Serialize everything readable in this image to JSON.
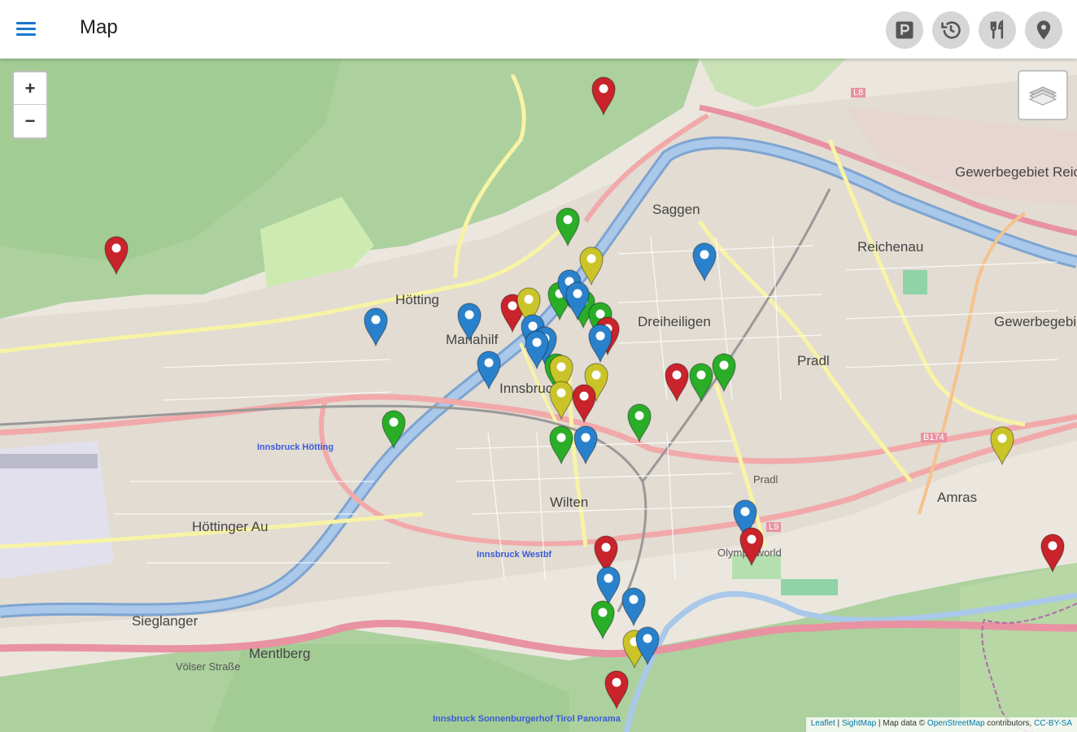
{
  "appbar": {
    "title": "Map",
    "actions": [
      {
        "icon": "parking-icon"
      },
      {
        "icon": "history-icon"
      },
      {
        "icon": "restaurant-icon"
      },
      {
        "icon": "location-pin-icon"
      }
    ]
  },
  "map": {
    "zoom_in": "+",
    "zoom_out": "−",
    "labels": {
      "innsbruck": "Innsbruck",
      "hoetting": "Hötting",
      "mariahilf": "Mariahilf",
      "saggen": "Saggen",
      "dreiheiligen": "Dreiheiligen",
      "pradl": "Pradl",
      "pradl2": "Pradl",
      "wilten": "Wilten",
      "reichenau": "Reichenau",
      "gewerbegebiet_reichenau": "Gewerbegebiet Reichenau",
      "gewerbegebiet_ko": "Gewerbegebiet Ko",
      "amras": "Amras",
      "hoettinger_au": "Höttinger Au",
      "mentlberg": "Mentlberg",
      "sieglanger": "Sieglanger",
      "olympiaworld": "Olympiaworld",
      "voelser_strasse": "Völser Straße",
      "innsbruck_hoetting": "Innsbruck Hötting",
      "innsbruck_westbf": "Innsbruck Westbf",
      "innsbruck_sonnenburgerhof": "Innsbruck Sonnenburgerhof Tirol Panorama",
      "b174": "B174",
      "l9": "L9",
      "l8": "L8"
    },
    "attribution": {
      "leaflet": "Leaflet",
      "separator": " | ",
      "sightmap": "SightMap",
      "data_prefix": " | Map data © ",
      "osm": "OpenStreetMap",
      "suffix": " contributors, ",
      "license": "CC-BY-SA"
    },
    "marker_colors": {
      "red": "#c9232b",
      "blue": "#2a81cb",
      "green": "#2aad27",
      "yellow": "#cac428"
    },
    "markers": [
      {
        "color": "red",
        "name": "marker-red"
      },
      {
        "color": "red",
        "name": "marker-red"
      },
      {
        "color": "green",
        "name": "marker-green"
      },
      {
        "color": "yellow",
        "name": "marker-yellow"
      },
      {
        "color": "blue",
        "name": "marker-blue"
      },
      {
        "color": "blue",
        "name": "marker-blue"
      },
      {
        "color": "blue",
        "name": "marker-blue"
      },
      {
        "color": "blue",
        "name": "marker-blue"
      },
      {
        "color": "red",
        "name": "marker-red"
      },
      {
        "color": "yellow",
        "name": "marker-yellow"
      },
      {
        "color": "green",
        "name": "marker-green"
      },
      {
        "color": "green",
        "name": "marker-green"
      },
      {
        "color": "blue",
        "name": "marker-blue"
      },
      {
        "color": "blue",
        "name": "marker-blue"
      },
      {
        "color": "green",
        "name": "marker-green"
      },
      {
        "color": "blue",
        "name": "marker-blue"
      },
      {
        "color": "blue",
        "name": "marker-blue"
      },
      {
        "color": "red",
        "name": "marker-red"
      },
      {
        "color": "blue",
        "name": "marker-blue"
      },
      {
        "color": "green",
        "name": "marker-green"
      },
      {
        "color": "yellow",
        "name": "marker-yellow"
      },
      {
        "color": "yellow",
        "name": "marker-yellow"
      },
      {
        "color": "red",
        "name": "marker-red"
      },
      {
        "color": "blue",
        "name": "marker-blue"
      },
      {
        "color": "green",
        "name": "marker-green"
      },
      {
        "color": "green",
        "name": "marker-green"
      },
      {
        "color": "red",
        "name": "marker-red"
      },
      {
        "color": "green",
        "name": "marker-green"
      },
      {
        "color": "green",
        "name": "marker-green"
      },
      {
        "color": "blue",
        "name": "marker-blue"
      },
      {
        "color": "green",
        "name": "marker-green"
      },
      {
        "color": "yellow",
        "name": "marker-yellow"
      },
      {
        "color": "yellow",
        "name": "marker-yellow"
      },
      {
        "color": "blue",
        "name": "marker-blue"
      },
      {
        "color": "red",
        "name": "marker-red"
      },
      {
        "color": "red",
        "name": "marker-red"
      },
      {
        "color": "red",
        "name": "marker-red"
      },
      {
        "color": "blue",
        "name": "marker-blue"
      },
      {
        "color": "blue",
        "name": "marker-blue"
      },
      {
        "color": "green",
        "name": "marker-green"
      },
      {
        "color": "yellow",
        "name": "marker-yellow"
      },
      {
        "color": "blue",
        "name": "marker-blue"
      },
      {
        "color": "red",
        "name": "marker-red"
      }
    ]
  }
}
